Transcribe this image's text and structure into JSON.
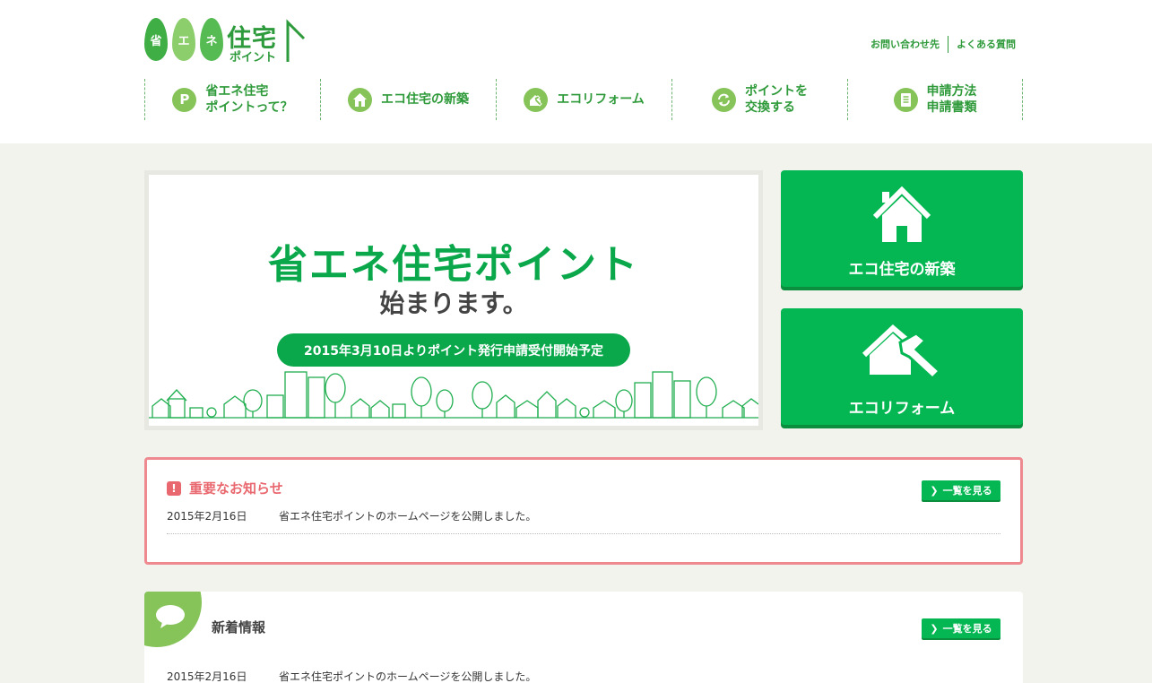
{
  "logo": {
    "leaf1": "省",
    "leaf2": "エ",
    "leaf3": "ネ",
    "main": "住宅",
    "sub": "ポイント"
  },
  "utility_nav": {
    "contact": "お問い合わせ先",
    "faq": "よくある質問"
  },
  "main_nav": [
    {
      "icon": "p-icon",
      "icon_text": "P",
      "label": "省エネ住宅\nポイントって？"
    },
    {
      "icon": "house-icon",
      "label": "エコ住宅の新築"
    },
    {
      "icon": "hammer-icon",
      "label": "エコリフォーム"
    },
    {
      "icon": "exchange-icon",
      "label": "ポイントを\n交換する"
    },
    {
      "icon": "document-icon",
      "label": "申請方法\n申請書類"
    }
  ],
  "hero": {
    "title": "省エネ住宅ポイント",
    "subtitle": "始まります。",
    "pill": "2015年3月10日よりポイント発行申請受付開始予定"
  },
  "cards": {
    "new_build": "エコ住宅の新築",
    "reform": "エコリフォーム"
  },
  "notice": {
    "icon_text": "!",
    "title": "重要なお知らせ",
    "more": "一覧を見る",
    "items": [
      {
        "date": "2015年2月16日",
        "text": "省エネ住宅ポイントのホームページを公開しました。"
      }
    ]
  },
  "news": {
    "title": "新着情報",
    "more": "一覧を見る",
    "items": [
      {
        "date": "2015年2月16日",
        "text": "省エネ住宅ポイントのホームページを公開しました。"
      }
    ]
  },
  "colors": {
    "brand_green": "#04b752",
    "text_green": "#2e9a3a",
    "light_green": "#86c45a",
    "notice_red": "#e9686f",
    "background": "#f3f3ee"
  }
}
